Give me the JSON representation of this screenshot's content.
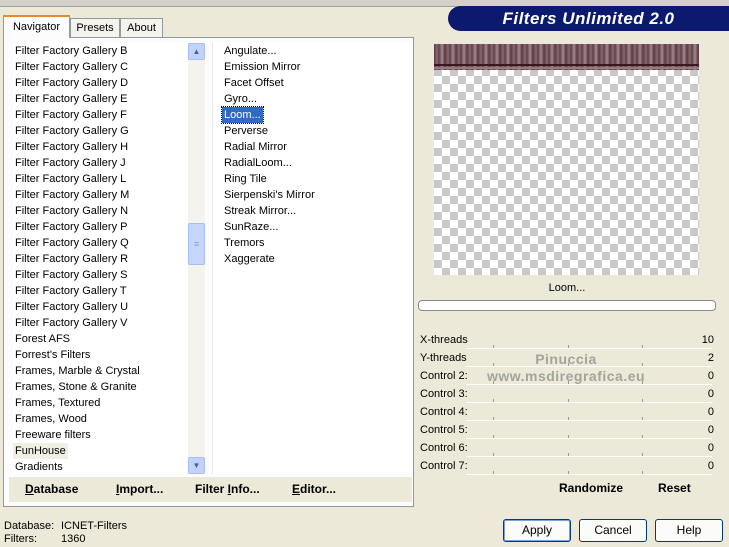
{
  "banner": {
    "title": "Filters Unlimited 2.0"
  },
  "tabs": [
    {
      "label": "Navigator",
      "active": true
    },
    {
      "label": "Presets",
      "active": false
    },
    {
      "label": "About",
      "active": false
    }
  ],
  "categories": [
    "Filter Factory Gallery B",
    "Filter Factory Gallery C",
    "Filter Factory Gallery D",
    "Filter Factory Gallery E",
    "Filter Factory Gallery F",
    "Filter Factory Gallery G",
    "Filter Factory Gallery H",
    "Filter Factory Gallery J",
    "Filter Factory Gallery L",
    "Filter Factory Gallery M",
    "Filter Factory Gallery N",
    "Filter Factory Gallery P",
    "Filter Factory Gallery Q",
    "Filter Factory Gallery R",
    "Filter Factory Gallery S",
    "Filter Factory Gallery T",
    "Filter Factory Gallery U",
    "Filter Factory Gallery V",
    "Forest AFS",
    "Forrest's Filters",
    "Frames, Marble & Crystal",
    "Frames, Stone & Granite",
    "Frames, Textured",
    "Frames, Wood",
    "Freeware filters",
    "FunHouse",
    "Gradients"
  ],
  "selected_category": "FunHouse",
  "filters": [
    "Angulate...",
    "Emission Mirror",
    "Facet Offset",
    "Gyro...",
    "Loom...",
    "Perverse",
    "Radial Mirror",
    "RadialLoom...",
    "Ring Tile",
    "Sierpenski's Mirror",
    "Streak Mirror...",
    "SunRaze...",
    "Tremors",
    "Xaggerate"
  ],
  "selected_filter": "Loom...",
  "toolbar": {
    "database": {
      "pre": "",
      "ul": "D",
      "post": "atabase"
    },
    "import": {
      "pre": "",
      "ul": "I",
      "post": "mport..."
    },
    "filter_info": {
      "pre": "Filter ",
      "ul": "I",
      "post": "nfo..."
    },
    "editor": {
      "pre": "",
      "ul": "E",
      "post": "ditor..."
    }
  },
  "preview": {
    "label": "Loom...",
    "progress": 0
  },
  "controls": [
    {
      "label": "X-threads",
      "value": "10"
    },
    {
      "label": "Y-threads",
      "value": "2"
    },
    {
      "label": "Control 2:",
      "value": "0"
    },
    {
      "label": "Control 3:",
      "value": "0"
    },
    {
      "label": "Control 4:",
      "value": "0"
    },
    {
      "label": "Control 5:",
      "value": "0"
    },
    {
      "label": "Control 6:",
      "value": "0"
    },
    {
      "label": "Control 7:",
      "value": "0"
    }
  ],
  "watermark": {
    "line1": "Pinuccia",
    "line2": "www.msdiregrafica.eu"
  },
  "randomize_label": "Randomize",
  "reset_label": "Reset",
  "status": {
    "database_label": "Database:",
    "database_value": "ICNET-Filters",
    "filters_label": "Filters:",
    "filters_value": "1360"
  },
  "buttons": {
    "apply": "Apply",
    "cancel": "Cancel",
    "help": "Help"
  }
}
